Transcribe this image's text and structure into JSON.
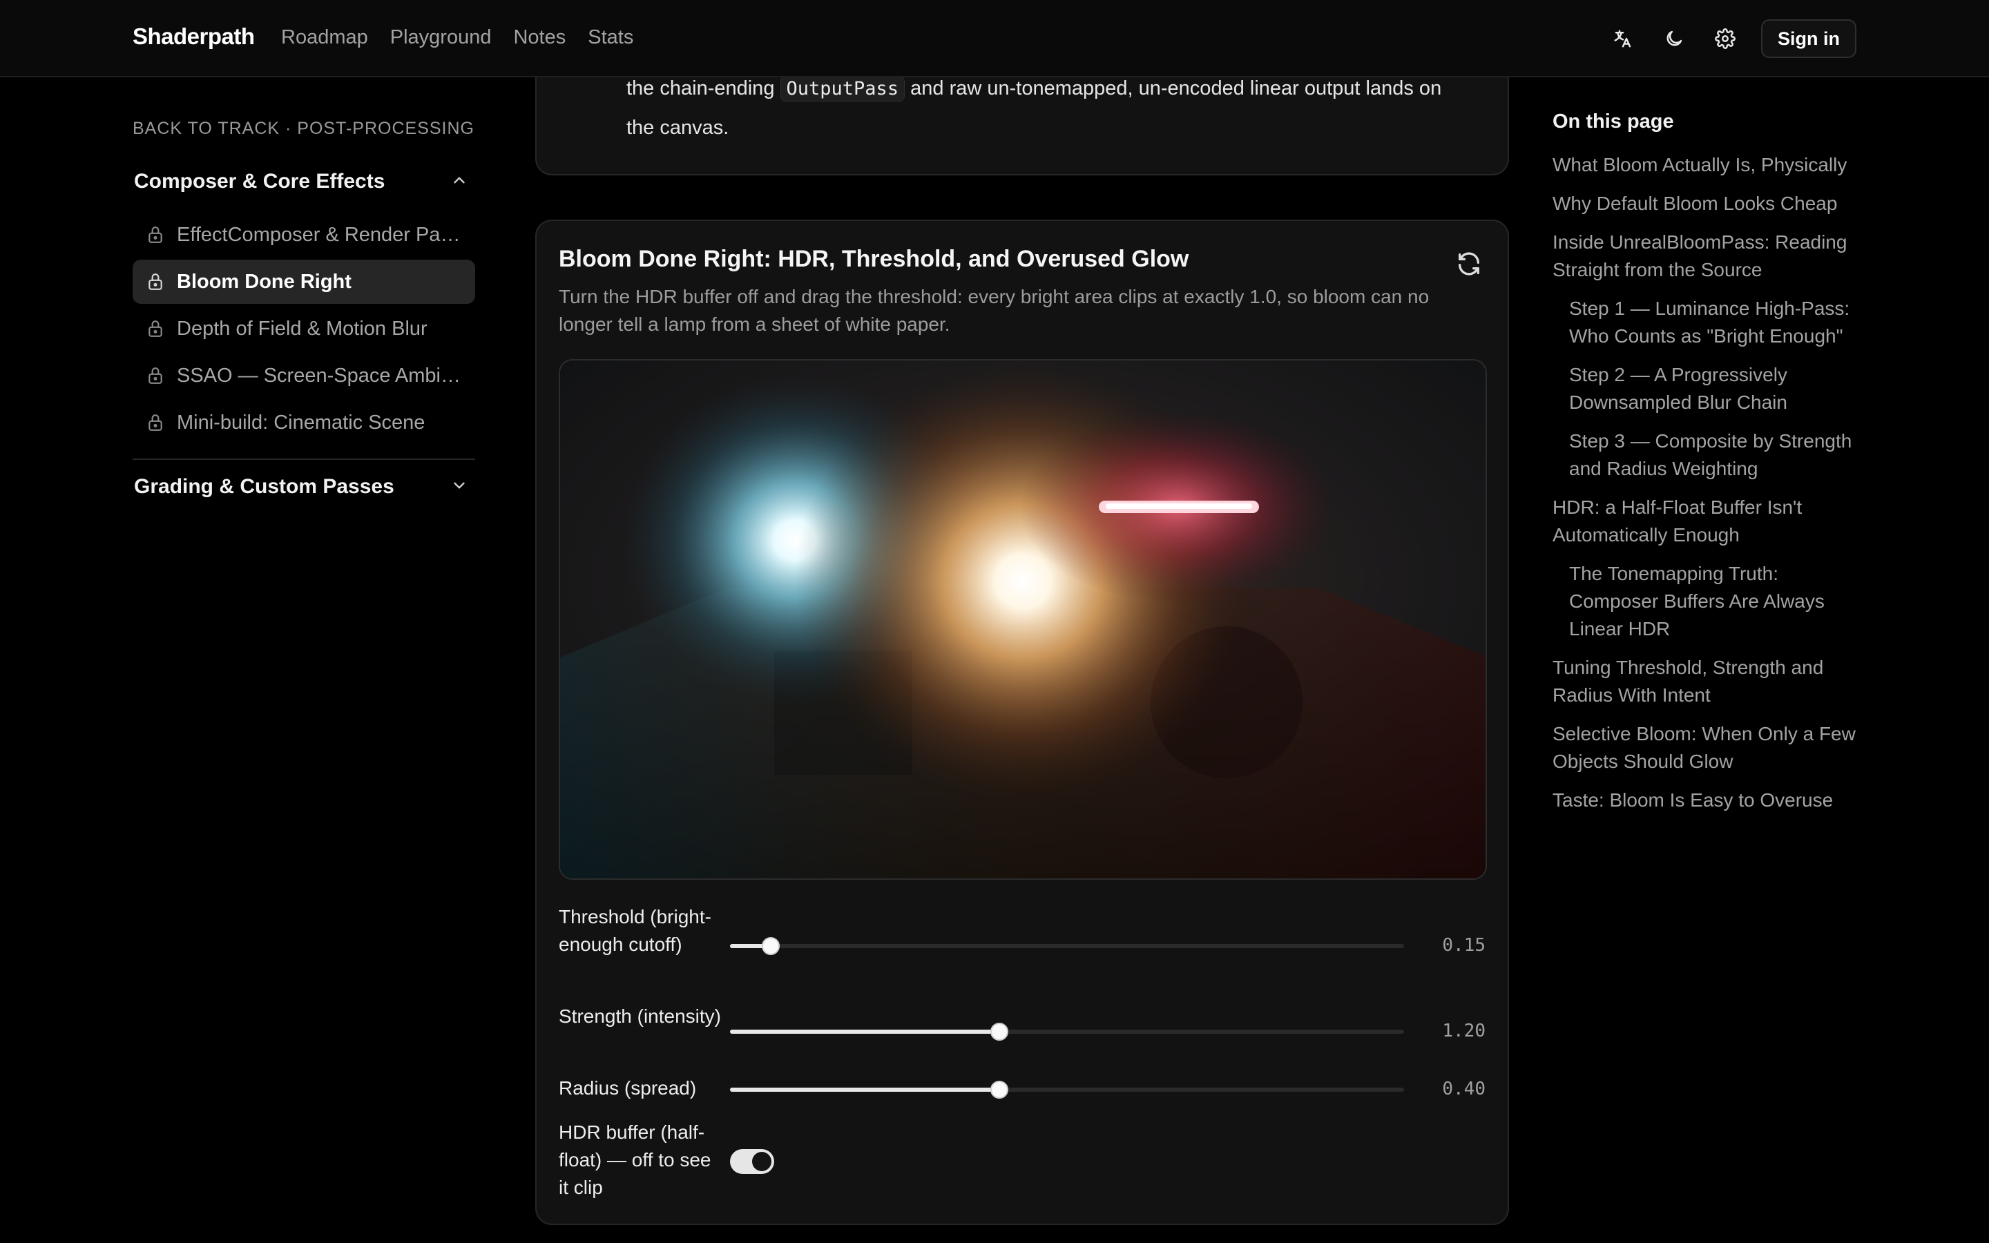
{
  "nav": {
    "brand": "Shaderpath",
    "links": [
      "Roadmap",
      "Playground",
      "Notes",
      "Stats"
    ],
    "icons": [
      "translate-icon",
      "moon-icon",
      "gear-icon"
    ],
    "signin": "Sign in"
  },
  "sidebar": {
    "back": "BACK TO TRACK · POST-PROCESSING",
    "groups": [
      {
        "title": "Composer & Core Effects",
        "expanded": true,
        "items": [
          {
            "label": "EffectComposer & Render Pass...",
            "locked": true,
            "active": false
          },
          {
            "label": "Bloom Done Right",
            "locked": true,
            "active": true
          },
          {
            "label": "Depth of Field & Motion Blur",
            "locked": true,
            "active": false
          },
          {
            "label": "SSAO — Screen-Space Ambien...",
            "locked": true,
            "active": false
          },
          {
            "label": "Mini-build: Cinematic Scene",
            "locked": true,
            "active": false
          }
        ]
      },
      {
        "title": "Grading & Custom Passes",
        "expanded": false
      }
    ]
  },
  "previous": {
    "line_before": "the chain-ending",
    "code": "OutputPass",
    "line_after": "and raw un-tonemapped, un-encoded linear output lands on the canvas."
  },
  "demo": {
    "title": "Bloom Done Right: HDR, Threshold, and Overused Glow",
    "description": "Turn the HDR buffer off and drag the threshold: every bright area clips at exactly 1.0, so bloom can no longer tell a lamp from a sheet of white paper.",
    "controls": {
      "threshold": {
        "label": "Threshold (bright-enough cutoff)",
        "value": 0.15,
        "display": "0.15",
        "fraction": 0.06
      },
      "strength": {
        "label": "Strength (intensity)",
        "value": 1.2,
        "display": "1.20",
        "fraction": 0.4
      },
      "radius": {
        "label": "Radius (spread)",
        "value": 0.4,
        "display": "0.40",
        "fraction": 0.4
      },
      "hdr": {
        "label": "HDR buffer (half-float) — off to see it clip",
        "on": true
      }
    }
  },
  "toc": {
    "title": "On this page",
    "items": [
      {
        "label": "What Bloom Actually Is, Physically",
        "sub": false
      },
      {
        "label": "Why Default Bloom Looks Cheap",
        "sub": false
      },
      {
        "label": "Inside UnrealBloomPass: Reading Straight from the Source",
        "sub": false
      },
      {
        "label": "Step 1 — Luminance High-Pass: Who Counts as \"Bright Enough\"",
        "sub": true
      },
      {
        "label": "Step 2 — A Progressively Downsampled Blur Chain",
        "sub": true
      },
      {
        "label": "Step 3 — Composite by Strength and Radius Weighting",
        "sub": true
      },
      {
        "label": "HDR: a Half-Float Buffer Isn't Automatically Enough",
        "sub": false
      },
      {
        "label": "The Tonemapping Truth: Composer Buffers Are Always Linear HDR",
        "sub": true
      },
      {
        "label": "Tuning Threshold, Strength and Radius With Intent",
        "sub": false
      },
      {
        "label": "Selective Bloom: When Only a Few Objects Should Glow",
        "sub": false
      },
      {
        "label": "Taste: Bloom Is Easy to Overuse",
        "sub": false
      }
    ]
  }
}
